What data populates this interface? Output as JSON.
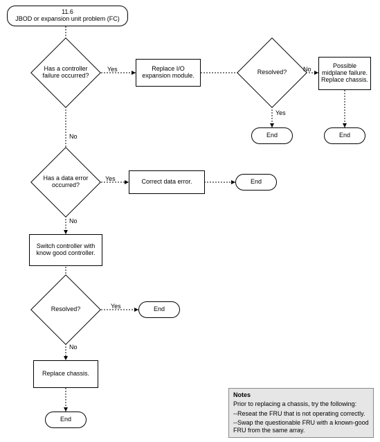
{
  "chart_data": {
    "type": "flowchart",
    "title": "11.6 JBOD or expansion unit problem (FC)",
    "nodes": [
      {
        "id": "start",
        "type": "terminator",
        "text": "11.6\nJBOD or expansion unit problem (FC)"
      },
      {
        "id": "d1",
        "type": "decision",
        "text": "Has a controller failure occurred?"
      },
      {
        "id": "p1",
        "type": "process",
        "text": "Replace I/O expansion module."
      },
      {
        "id": "d2",
        "type": "decision",
        "text": "Resolved?"
      },
      {
        "id": "p2",
        "type": "process",
        "text": "Possible midplane failure. Replace chassis."
      },
      {
        "id": "end1",
        "type": "terminator",
        "text": "End"
      },
      {
        "id": "end2",
        "type": "terminator",
        "text": "End"
      },
      {
        "id": "d3",
        "type": "decision",
        "text": "Has a data error occurred?"
      },
      {
        "id": "p3",
        "type": "process",
        "text": "Correct data error."
      },
      {
        "id": "end3",
        "type": "terminator",
        "text": "End"
      },
      {
        "id": "p4",
        "type": "process",
        "text": "Switch controller with know good controller."
      },
      {
        "id": "d4",
        "type": "decision",
        "text": "Resolved?"
      },
      {
        "id": "end4",
        "type": "terminator",
        "text": "End"
      },
      {
        "id": "p5",
        "type": "process",
        "text": "Replace chassis."
      },
      {
        "id": "end5",
        "type": "terminator",
        "text": "End"
      }
    ],
    "edges": [
      {
        "from": "start",
        "to": "d1"
      },
      {
        "from": "d1",
        "to": "p1",
        "label": "Yes"
      },
      {
        "from": "p1",
        "to": "d2"
      },
      {
        "from": "d2",
        "to": "p2",
        "label": "No"
      },
      {
        "from": "d2",
        "to": "end1",
        "label": "Yes"
      },
      {
        "from": "p2",
        "to": "end2"
      },
      {
        "from": "d1",
        "to": "d3",
        "label": "No"
      },
      {
        "from": "d3",
        "to": "p3",
        "label": "Yes"
      },
      {
        "from": "p3",
        "to": "end3"
      },
      {
        "from": "d3",
        "to": "p4",
        "label": "No"
      },
      {
        "from": "p4",
        "to": "d4"
      },
      {
        "from": "d4",
        "to": "end4",
        "label": "Yes"
      },
      {
        "from": "d4",
        "to": "p5",
        "label": "No"
      },
      {
        "from": "p5",
        "to": "end5"
      }
    ]
  },
  "start": {
    "line1": "11.6",
    "line2": "JBOD or expansion unit problem (FC)"
  },
  "d1": {
    "text": "Has a controller failure occurred?"
  },
  "p1": {
    "text": "Replace I/O expansion module."
  },
  "d2": {
    "text": "Resolved?"
  },
  "p2": {
    "text": "Possible midplane failure. Replace chassis."
  },
  "end1": {
    "text": "End"
  },
  "end2": {
    "text": "End"
  },
  "d3": {
    "text": "Has a data error occurred?"
  },
  "p3": {
    "text": "Correct data error."
  },
  "end3": {
    "text": "End"
  },
  "p4": {
    "text": "Switch controller with know good controller."
  },
  "d4": {
    "text": "Resolved?"
  },
  "end4": {
    "text": "End"
  },
  "p5": {
    "text": "Replace chassis."
  },
  "end5": {
    "text": "End"
  },
  "labels": {
    "yes": "Yes",
    "no": "No"
  },
  "notes": {
    "title": "Notes",
    "line1": "Prior to replacing a chassis, try the following:",
    "item1": "--Reseat the FRU that is not operating correctly.",
    "item2": "--Swap the questionable FRU with a known-good FRU from the same array."
  }
}
